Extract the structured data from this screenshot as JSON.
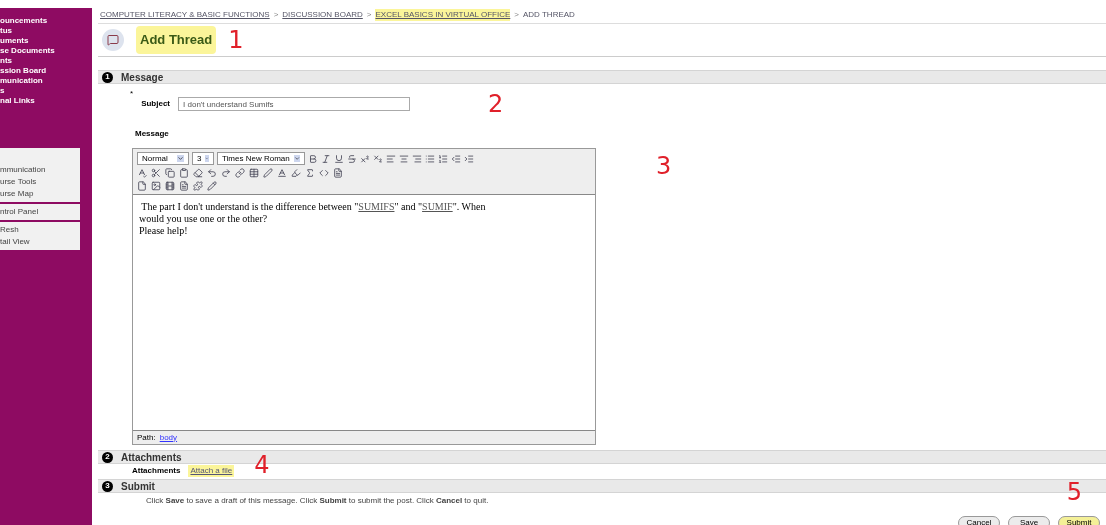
{
  "sidebar": {
    "links": [
      "ouncements",
      "tus",
      "uments",
      "se Documents",
      "nts",
      "ssion Board",
      "munication",
      "s",
      "nal Links"
    ],
    "panels": [
      [
        "mmunication",
        "urse Tools",
        "urse Map"
      ],
      [
        "ntrol Panel"
      ],
      [
        "Resh",
        "tail View"
      ]
    ]
  },
  "breadcrumb_separator": ">",
  "breadcrumb": [
    {
      "label": "COMPUTER LITERACY & BASIC FUNCTIONS",
      "highlighted": false
    },
    {
      "label": "DISCUSSION BOARD",
      "highlighted": false
    },
    {
      "label": "EXCEL BASICS IN VIRTUAL OFFICE",
      "highlighted": true
    },
    {
      "label": "ADD THREAD",
      "highlighted": false
    }
  ],
  "page_title": {
    "text": "Add Thread",
    "highlighted": true,
    "note": "1"
  },
  "sections": [
    {
      "number": "1",
      "title": "Message"
    },
    {
      "number": "2",
      "title": "Attachments"
    },
    {
      "number": "3",
      "title": "Submit"
    }
  ],
  "subject": {
    "required_mark": "*",
    "label": "Subject",
    "value": "I don't understand Sumifs",
    "note": "2"
  },
  "message": {
    "label": "Message",
    "note": "3",
    "toolbar": {
      "format": "Normal",
      "size": "3",
      "font": "Times New Roman"
    },
    "lines": [
      [
        {
          "text": " The part I don't understand is the difference between \"",
          "link": false
        },
        {
          "text": "SUMIFS",
          "link": true
        },
        {
          "text": "\" and \"",
          "link": false
        },
        {
          "text": "SUMIF",
          "link": true
        },
        {
          "text": "\". When",
          "link": false
        }
      ],
      [
        {
          "text": "would you use one or the other?",
          "link": false
        }
      ],
      [
        {
          "text": "Please help!",
          "link": false
        }
      ]
    ],
    "path_label": "Path:",
    "path_value": "body"
  },
  "attachments": {
    "label": "Attachments",
    "link": "Attach a file",
    "highlighted": true,
    "note": "4"
  },
  "submit": {
    "instructions": "Click **Save** to save a draft of this message. Click **Submit** to submit the post. Click **Cancel** to quit.",
    "note": "5",
    "buttons": [
      {
        "label": "Cancel",
        "highlighted": false
      },
      {
        "label": "Save",
        "highlighted": false
      },
      {
        "label": "Submit",
        "highlighted": true
      }
    ]
  }
}
